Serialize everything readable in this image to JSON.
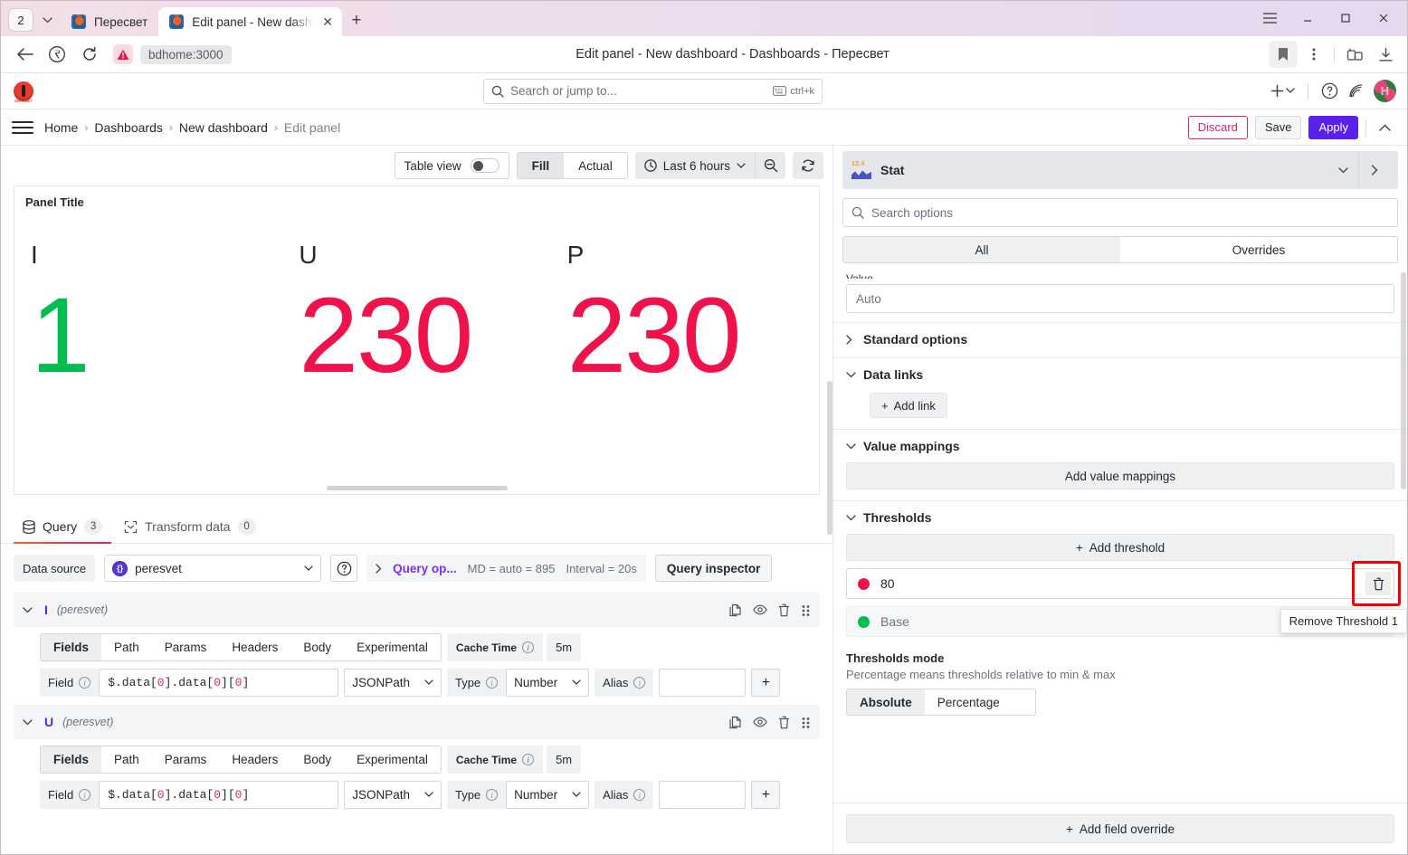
{
  "browser": {
    "tab_counter": "2",
    "tabs": [
      {
        "title": "Пересвет",
        "active": false
      },
      {
        "title": "Edit panel - New dashbo",
        "active": true
      }
    ],
    "url": "bdhome:3000",
    "page_title": "Edit panel - New dashboard - Dashboards - Пересвет",
    "icons": {
      "back": "back-arrow-icon",
      "extension": "extension-icon",
      "reload": "reload-icon",
      "warning": "warning-icon",
      "bookmark": "bookmark-icon",
      "menu": "kebab-menu-icon",
      "split": "split-view-icon",
      "downloads": "downloads-icon",
      "minimize": "minimize-icon",
      "maximize": "maximize-icon",
      "close": "close-icon",
      "app_menu": "hamburger-menu-icon"
    }
  },
  "topnav": {
    "search_placeholder": "Search or jump to...",
    "kbd_hint": "ctrl+k",
    "add_label": "+",
    "logo_caption": "ПЕРЕСВЕТ"
  },
  "breadcrumb": {
    "items": [
      "Home",
      "Dashboards",
      "New dashboard",
      "Edit panel"
    ],
    "separator": "›",
    "actions": {
      "discard": "Discard",
      "save": "Save",
      "apply": "Apply"
    }
  },
  "viz_toolbar": {
    "table_view_label": "Table view",
    "table_view_on": false,
    "fill_label": "Fill",
    "actual_label": "Actual",
    "fill_selected": true,
    "time_range": "Last 6 hours",
    "zoom_out_icon": "zoom-out-icon",
    "refresh_icon": "refresh-icon",
    "clock_icon": "clock-icon"
  },
  "panel": {
    "title": "Panel Title",
    "stats": [
      {
        "name": "I",
        "value": "1",
        "color": "#00bd52"
      },
      {
        "name": "U",
        "value": "230",
        "color": "#f0124a"
      },
      {
        "name": "P",
        "value": "230",
        "color": "#f0124a"
      }
    ]
  },
  "query_tabs": [
    {
      "label": "Query",
      "count": "3",
      "active": true,
      "icon": "database-icon"
    },
    {
      "label": "Transform data",
      "count": "0",
      "active": false,
      "icon": "transform-icon"
    }
  ],
  "datasource_row": {
    "label": "Data source",
    "value": "peresvet",
    "help_icon": "help-circle-icon",
    "query_options_label": "Query op...",
    "md_text": "MD = auto = 895",
    "interval_text": "Interval = 20s",
    "query_inspector_label": "Query inspector"
  },
  "queries": [
    {
      "ref": "I",
      "datasource": "(peresvet)",
      "tabs": [
        "Fields",
        "Path",
        "Params",
        "Headers",
        "Body",
        "Experimental"
      ],
      "active_tab": "Fields",
      "cache_time_label": "Cache Time",
      "cache_time_value": "5m",
      "field_label": "Field",
      "field_value": "$.data[0].data[0][0]",
      "parser": "JSONPath",
      "type_label": "Type",
      "type_value": "Number",
      "alias_label": "Alias",
      "alias_value": "",
      "add_label": "+",
      "actions": [
        "duplicate-icon",
        "hide-icon",
        "delete-icon",
        "drag-handle-icon"
      ]
    },
    {
      "ref": "U",
      "datasource": "(peresvet)",
      "tabs": [
        "Fields",
        "Path",
        "Params",
        "Headers",
        "Body",
        "Experimental"
      ],
      "active_tab": "Fields",
      "cache_time_label": "Cache Time",
      "cache_time_value": "5m",
      "field_label": "Field",
      "field_value": "$.data[0].data[0][0]",
      "parser": "JSONPath",
      "type_label": "Type",
      "type_value": "Number",
      "alias_label": "Alias",
      "alias_value": "",
      "add_label": "+",
      "actions": [
        "duplicate-icon",
        "hide-icon",
        "delete-icon",
        "drag-handle-icon"
      ]
    }
  ],
  "options": {
    "viz_name": "Stat",
    "search_placeholder": "Search options",
    "tabs": {
      "all": "All",
      "overrides": "Overrides",
      "active": "All"
    },
    "value_field_placeholder": "Auto",
    "sections": {
      "standard_options": "Standard options",
      "data_links": "Data links",
      "value_mappings": "Value mappings",
      "thresholds": "Thresholds"
    },
    "add_link_label": "Add link",
    "add_value_mappings_label": "Add value mappings",
    "add_threshold_label": "Add threshold",
    "thresholds": [
      {
        "value": "80",
        "color": "#f0124a",
        "removable": true
      },
      {
        "value": "Base",
        "color": "#00bd52",
        "removable": false
      }
    ],
    "thresholds_mode_title": "Thresholds mode",
    "thresholds_mode_sub": "Percentage means thresholds relative to min & max",
    "mode_absolute": "Absolute",
    "mode_percentage": "Percentage",
    "mode_selected": "Absolute",
    "add_field_override_label": "Add field override",
    "tooltip": "Remove Threshold 1",
    "highlight_color": "#f50000"
  }
}
